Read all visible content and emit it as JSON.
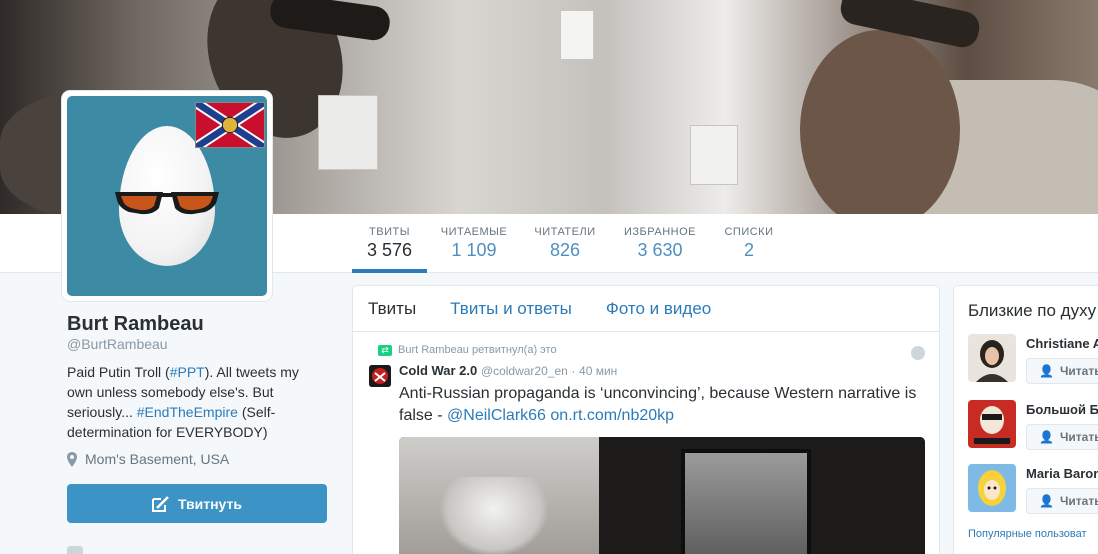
{
  "profile": {
    "name": "Burt Rambeau",
    "handle": "@BurtRambeau",
    "bio_part1": "Paid Putin Troll (",
    "bio_hashtag1": "#PPT",
    "bio_part2": "). All tweets my own unless somebody else's. But seriously... ",
    "bio_hashtag2": "#EndTheEmpire",
    "bio_part3": " (Self-determination for EVERYBODY)",
    "location": "Mom's Basement, USA",
    "tweet_button_label": "Твитнуть"
  },
  "stats": [
    {
      "label": "ТВИТЫ",
      "value": "3 576"
    },
    {
      "label": "ЧИТАЕМЫЕ",
      "value": "1 109"
    },
    {
      "label": "ЧИТАТЕЛИ",
      "value": "826"
    },
    {
      "label": "ИЗБРАННОЕ",
      "value": "3 630"
    },
    {
      "label": "СПИСКИ",
      "value": "2"
    }
  ],
  "timeline": {
    "tabs": [
      {
        "label": "Твиты"
      },
      {
        "label": "Твиты и ответы"
      },
      {
        "label": "Фото и видео"
      }
    ],
    "tweet": {
      "retweet_context": "Burt Rambeau ретвитнул(а) это",
      "author_name": "Cold War 2.0",
      "author_handle": "@coldwar20_en",
      "separator": "·",
      "time": "40 мин",
      "text_main": "Anti-Russian propaganda is ‘unconvincing’, because Western narrative is false - ",
      "text_mention": "@NeilClark66",
      "text_link": "on.rt.com/nb20kp"
    }
  },
  "sidebar": {
    "title": "Близкие по духу",
    "users": [
      {
        "name": "Christiane A",
        "follow_label": "Читать"
      },
      {
        "name": "Большой Б",
        "follow_label": "Читать"
      },
      {
        "name": "Maria Baron",
        "follow_label": "Читать"
      }
    ],
    "footer": "Популярные пользоват"
  },
  "colors": {
    "accent": "#2b7bb9",
    "button": "#3b94c5",
    "avatar_bg": "#3d8aa5",
    "retweet_green": "#19cf86"
  }
}
